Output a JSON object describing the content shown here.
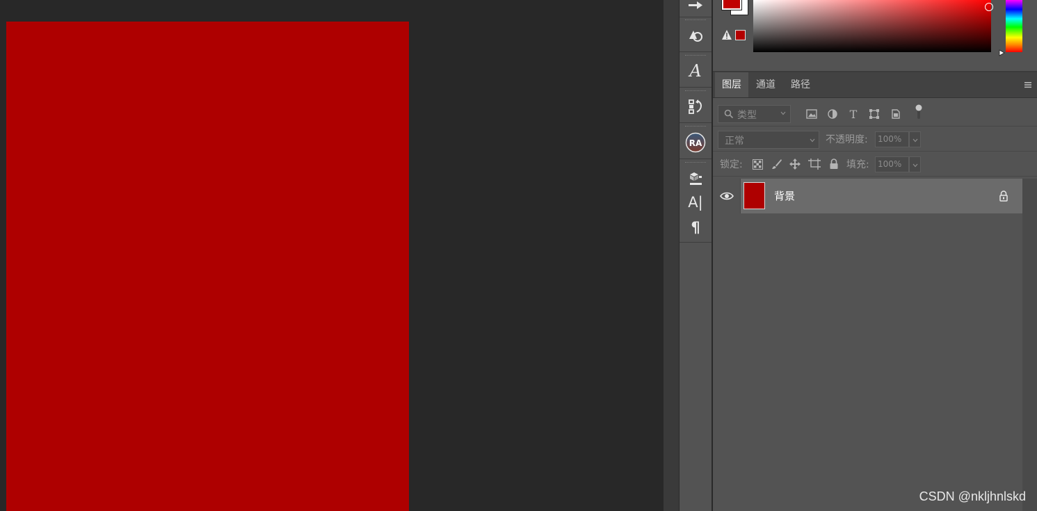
{
  "colors": {
    "document_fill": "#ae0000",
    "foreground": "#c00000",
    "background": "#ffffff"
  },
  "layers_panel": {
    "tabs": [
      {
        "label": "图层"
      },
      {
        "label": "通道"
      },
      {
        "label": "路径"
      }
    ],
    "filter": {
      "placeholder": "类型"
    },
    "blend_mode": "正常",
    "opacity": {
      "label": "不透明度:",
      "value": "100%"
    },
    "lock": {
      "label": "锁定:"
    },
    "fill": {
      "label": "填充:",
      "value": "100%"
    },
    "layers": [
      {
        "name": "背景",
        "locked": true
      }
    ]
  },
  "tool_dock_icons": [
    "brush-settings-icon",
    "clone-source-icon",
    "glyphs-icon",
    "history-icon",
    "ra-plugin-icon",
    "3d-icon",
    "character-icon",
    "paragraph-icon"
  ],
  "watermark": "CSDN @nkljhnlskd"
}
